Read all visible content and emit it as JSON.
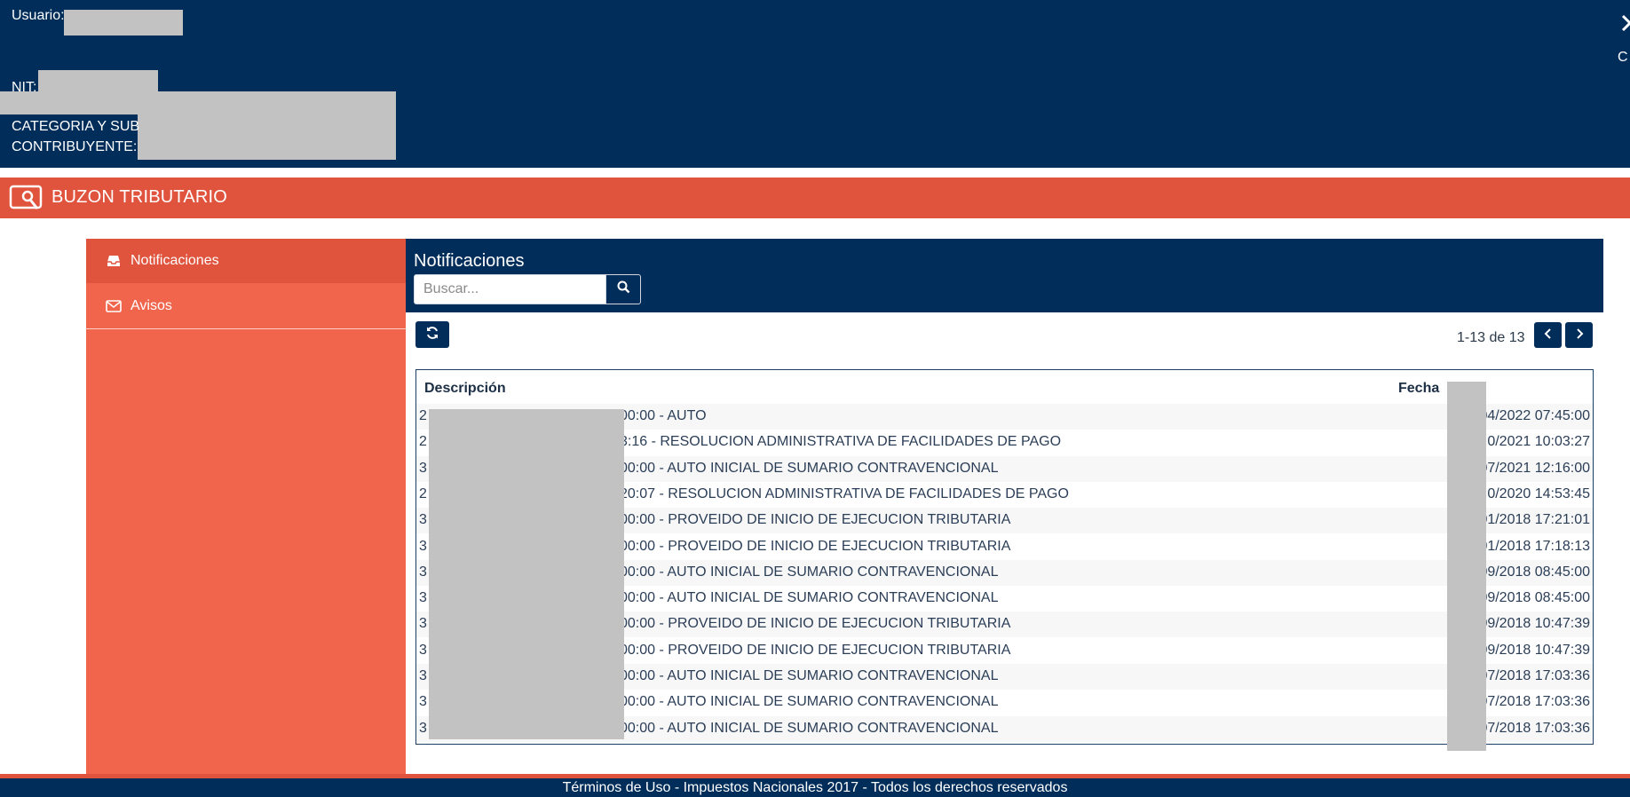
{
  "header": {
    "usuario_label": "Usuario:",
    "nit_label": "NIT:",
    "categoria_label_1": "CATEGORIA Y SUB",
    "categoria_label_2": "CONTRIBUYENTE:",
    "right_text": "C"
  },
  "band": {
    "title": "BUZON TRIBUTARIO"
  },
  "sidebar": {
    "items": [
      {
        "label": "Notificaciones",
        "icon": "inbox-icon",
        "active": true
      },
      {
        "label": "Avisos",
        "icon": "envelope-icon",
        "active": false
      }
    ]
  },
  "main": {
    "title": "Notificaciones",
    "search": {
      "placeholder": "Buscar...",
      "value": ""
    },
    "pager": "1-13 de 13"
  },
  "table": {
    "headers": {
      "description": "Descripción",
      "date": "Fecha"
    },
    "rows": [
      {
        "prefix": "2",
        "desc": "00:00 - AUTO",
        "date": "04/2022 07:45:00"
      },
      {
        "prefix": "2",
        "desc": "3:16 - RESOLUCION ADMINISTRATIVA DE FACILIDADES DE PAGO",
        "date": "0/2021 10:03:27"
      },
      {
        "prefix": "3",
        "desc": "00:00 - AUTO INICIAL DE SUMARIO CONTRAVENCIONAL",
        "date": "07/2021 12:16:00"
      },
      {
        "prefix": "2",
        "desc": "20:07 - RESOLUCION ADMINISTRATIVA DE FACILIDADES DE PAGO",
        "date": "0/2020 14:53:45"
      },
      {
        "prefix": "3",
        "desc": "00:00 - PROVEIDO DE INICIO DE EJECUCION TRIBUTARIA",
        "date": "01/2018 17:21:01"
      },
      {
        "prefix": "3",
        "desc": "00:00 - PROVEIDO DE INICIO DE EJECUCION TRIBUTARIA",
        "date": "01/2018 17:18:13"
      },
      {
        "prefix": "3",
        "desc": "00:00 - AUTO INICIAL DE SUMARIO CONTRAVENCIONAL",
        "date": "09/2018 08:45:00"
      },
      {
        "prefix": "3",
        "desc": "00:00 - AUTO INICIAL DE SUMARIO CONTRAVENCIONAL",
        "date": "09/2018 08:45:00"
      },
      {
        "prefix": "3",
        "desc": "00:00 - PROVEIDO DE INICIO DE EJECUCION TRIBUTARIA",
        "date": "09/2018 10:47:39"
      },
      {
        "prefix": "3",
        "desc": "00:00 - PROVEIDO DE INICIO DE EJECUCION TRIBUTARIA",
        "date": "09/2018 10:47:39"
      },
      {
        "prefix": "3",
        "desc": "00:00 - AUTO INICIAL DE SUMARIO CONTRAVENCIONAL",
        "date": "07/2018 17:03:36"
      },
      {
        "prefix": "3",
        "desc": "00:00 - AUTO INICIAL DE SUMARIO CONTRAVENCIONAL",
        "date": "07/2018 17:03:36"
      },
      {
        "prefix": "3",
        "desc": "00:00 - AUTO INICIAL DE SUMARIO CONTRAVENCIONAL",
        "date": "07/2018 17:03:36"
      }
    ]
  },
  "footer": {
    "text": "Términos de Uso - Impuestos Nacionales 2017 - Todos los derechos reservados"
  },
  "colors": {
    "navy": "#002d5a",
    "band": "#e0533d",
    "sidebar": "#f0654c"
  }
}
